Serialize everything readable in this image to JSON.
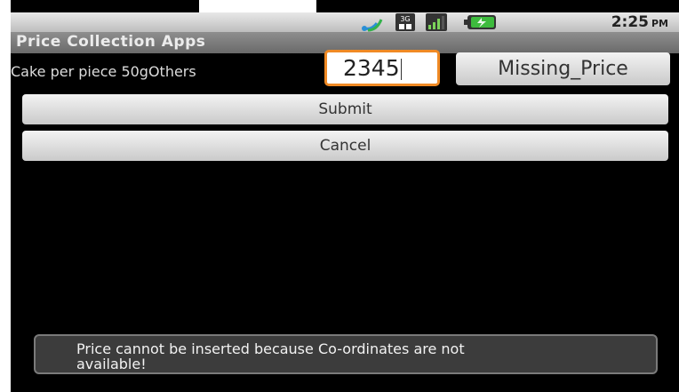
{
  "status_bar": {
    "time": "2:25",
    "ampm": "PM",
    "icons": [
      "wifi-signal-icon",
      "3g-icon",
      "cell-signal-icon",
      "battery-icon"
    ]
  },
  "app": {
    "title": "Price Collection Apps"
  },
  "form": {
    "item_label": "Cake per piece 50gOthers",
    "price_value": "2345",
    "missing_button": "Missing_Price",
    "submit_button": "Submit",
    "cancel_button": "Cancel"
  },
  "toast": {
    "message": "Price cannot be inserted because Co-ordinates are not available!"
  },
  "colors": {
    "focus_border": "#f08a24",
    "background": "#000000"
  }
}
